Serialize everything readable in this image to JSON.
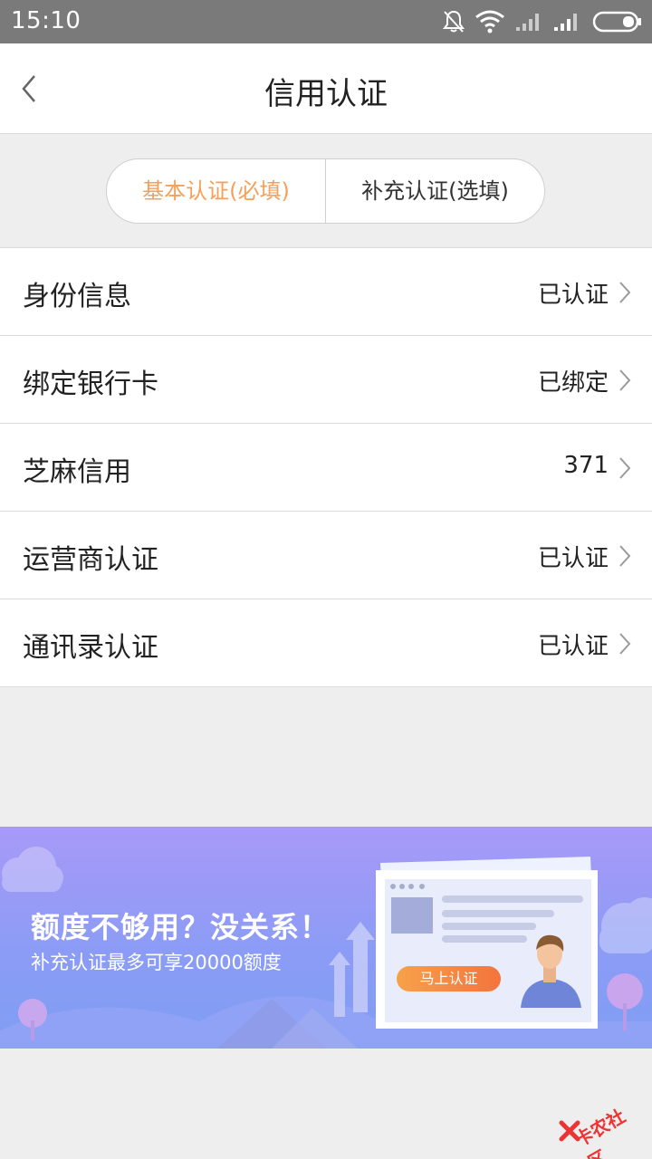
{
  "status_bar": {
    "time": "15:10",
    "icons": [
      "mute-bell-icon",
      "wifi-icon",
      "signal-icon",
      "signal-icon",
      "battery-icon"
    ]
  },
  "nav": {
    "title": "信用认证",
    "back_icon": "chevron-left-icon"
  },
  "segments": [
    {
      "label": "基本认证(必填)",
      "active": true
    },
    {
      "label": "补充认证(选填)",
      "active": false
    }
  ],
  "items": [
    {
      "label": "身份信息",
      "value": "已认证"
    },
    {
      "label": "绑定银行卡",
      "value": "已绑定"
    },
    {
      "label": "芝麻信用",
      "value": "371"
    },
    {
      "label": "运营商认证",
      "value": "已认证"
    },
    {
      "label": "通讯录认证",
      "value": "已认证"
    }
  ],
  "banner": {
    "headline": "额度不够用？没关系！",
    "subline": "补充认证最多可享20000额度",
    "cta": "马上认证"
  },
  "watermark": {
    "text": "卡农社区"
  },
  "colors": {
    "accent": "#f5a05a",
    "banner_top": "#a899f7",
    "banner_bottom": "#7f9ef3",
    "cta": "#f4743b"
  }
}
